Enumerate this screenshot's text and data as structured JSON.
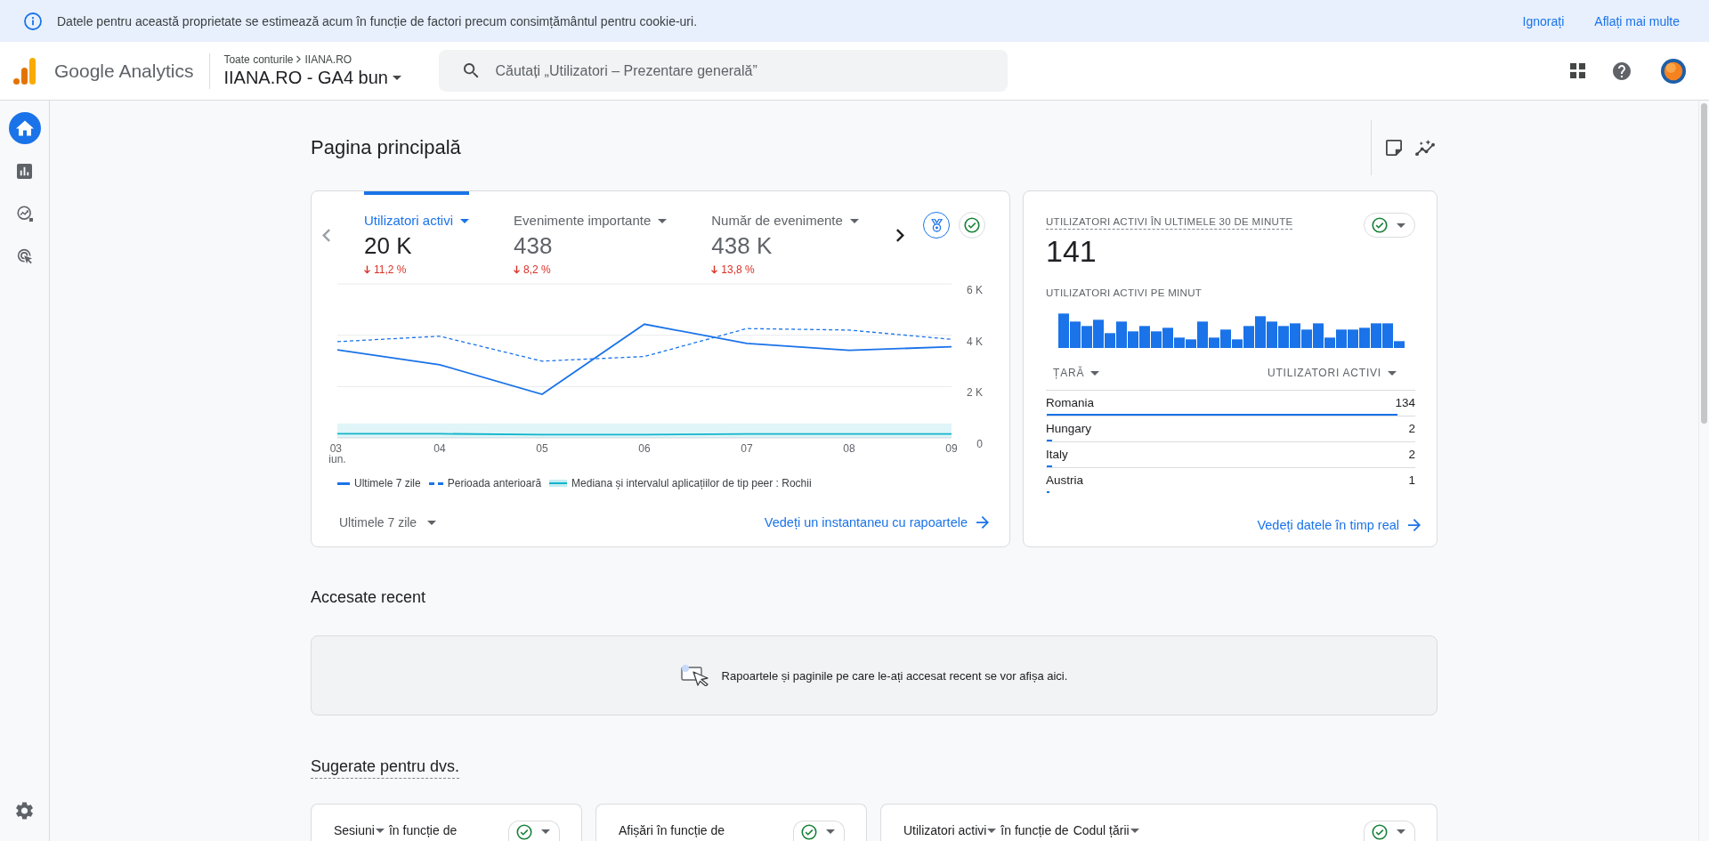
{
  "banner": {
    "message": "Datele pentru această proprietate se estimează acum în funcție de factori precum consimțământul pentru cookie-uri.",
    "actions": [
      "Ignorați",
      "Aflați mai multe"
    ]
  },
  "header": {
    "product": "Google Analytics",
    "breadcrumb": [
      "Toate conturile",
      "IIANA.RO"
    ],
    "property": "IIANA.RO - GA4 bun",
    "search": {
      "placeholder": "Căutați „Utilizatori – Prezentare generală”"
    }
  },
  "sidebar": {
    "items": [
      {
        "kind": "home",
        "selected": true
      },
      {
        "kind": "reports",
        "selected": false
      },
      {
        "kind": "explore",
        "selected": false
      },
      {
        "kind": "advertising",
        "selected": false
      }
    ]
  },
  "page": {
    "title": "Pagina principală"
  },
  "overview_card": {
    "metrics": [
      {
        "label": "Utilizatori activi",
        "value": "20 K",
        "change": "11,2 %",
        "down": true,
        "selected": true
      },
      {
        "label": "Evenimente importante",
        "value": "438",
        "change": "8,2 %",
        "down": true,
        "selected": false
      },
      {
        "label": "Număr de evenimente",
        "value": "438 K",
        "change": "13,8 %",
        "down": true,
        "selected": false
      }
    ],
    "chart_data": {
      "type": "line",
      "categories": [
        "03 iun.",
        "04",
        "05",
        "06",
        "07",
        "08",
        "09"
      ],
      "ylim": [
        0,
        6000
      ],
      "yticks": [
        {
          "value": 0,
          "label": "0"
        },
        {
          "value": 2000,
          "label": "2 K"
        },
        {
          "value": 4000,
          "label": "4 K"
        },
        {
          "value": 6000,
          "label": "6 K"
        }
      ],
      "series": [
        {
          "name": "Ultimele 7 zile",
          "color": "#1a73e8",
          "line_style": "solid",
          "values": [
            3430,
            2850,
            1700,
            4430,
            3680,
            3410,
            3550
          ]
        },
        {
          "name": "Perioada anterioară",
          "color": "#1a73e8",
          "line_style": "dashed",
          "values": [
            3750,
            3960,
            2990,
            3170,
            4260,
            4200,
            3840
          ]
        },
        {
          "name": "Mediana și intervalul aplicațiilor de tip peer : Rochii",
          "color": "#12b5cb",
          "line_style": "solid",
          "values": [
            160,
            160,
            130,
            130,
            150,
            150,
            150
          ]
        }
      ]
    },
    "range": "Ultimele 7 zile",
    "link": "Vedeți un instantaneu cu rapoartele"
  },
  "realtime_card": {
    "title": "UTILIZATORI ACTIVI ÎN ULTIMELE 30 DE MINUTE",
    "value": "141",
    "per_minute_title": "UTILIZATORI ACTIVI PE MINUT",
    "columns": [
      "ȚARĂ",
      "UTILIZATORI ACTIVI"
    ],
    "rows": [
      {
        "country": "Romania",
        "users": "134",
        "level": 1
      },
      {
        "country": "Hungary",
        "users": "2",
        "level": 0.015
      },
      {
        "country": "Italy",
        "users": "2",
        "level": 0.015
      },
      {
        "country": "Austria",
        "users": "1",
        "level": 0.0075
      }
    ],
    "link": "Vedeți datele în timp real"
  },
  "recent": {
    "title": "Accesate recent",
    "empty_message": "Rapoartele și paginile pe care le-ați accesat recent se vor afișa aici."
  },
  "suggested": {
    "title": "Sugerate pentru dvs.",
    "cards": [
      {
        "title": [
          {
            "text": "Sesiuni",
            "dropdown": true
          },
          {
            "text": "în funcție de",
            "dropdown": false
          }
        ]
      },
      {
        "title": [
          {
            "text": "Afișări în funcție de",
            "dropdown": false
          }
        ]
      },
      {
        "title": [
          {
            "text": "Utilizatori activi",
            "dropdown": true
          },
          {
            "text": "în funcție de",
            "dropdown": false
          },
          {
            "text": "Codul țării",
            "dropdown": true
          }
        ]
      }
    ]
  }
}
